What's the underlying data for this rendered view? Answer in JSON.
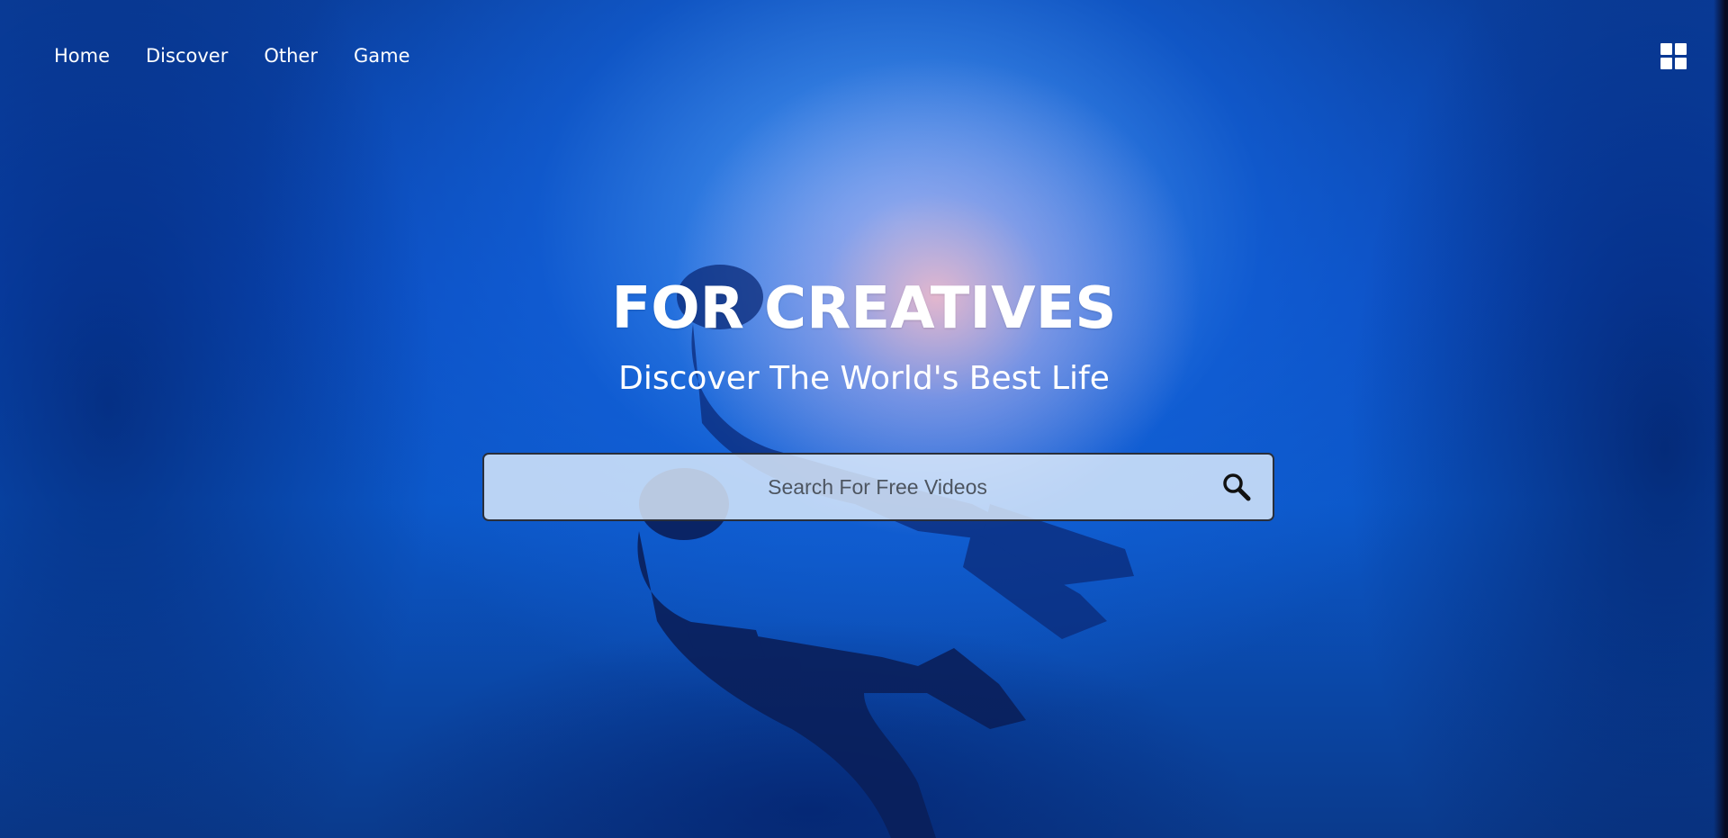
{
  "nav": {
    "items": [
      {
        "label": "Home"
      },
      {
        "label": "Discover"
      },
      {
        "label": "Other"
      },
      {
        "label": "Game"
      }
    ]
  },
  "menu_icon": "grid-menu-icon",
  "hero": {
    "title": "FOR CREATIVES",
    "subtitle": "Discover The World's Best Life"
  },
  "search": {
    "placeholder": "Search For Free Videos",
    "value": "",
    "icon": "search-icon"
  },
  "colors": {
    "text": "#ffffff",
    "search_border": "#2a2f3a",
    "background_primary": "#0a4cc0"
  }
}
